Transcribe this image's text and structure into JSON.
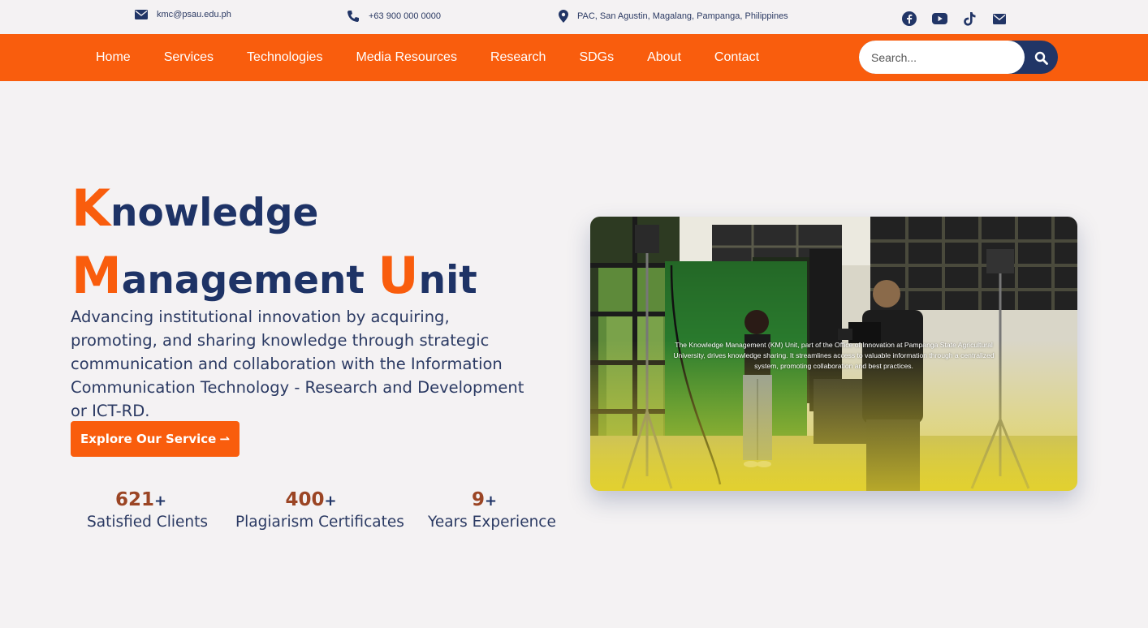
{
  "topbar": {
    "email": "kmc@psau.edu.ph",
    "phone": "+63 900 000 0000",
    "address": "PAC, San Agustin, Magalang, Pampanga, Philippines",
    "socials": [
      "facebook-icon",
      "youtube-icon",
      "tiktok-icon",
      "mail-icon"
    ]
  },
  "nav": {
    "items": [
      "Home",
      "Services",
      "Technologies",
      "Media Resources",
      "Research",
      "SDGs",
      "About",
      "Contact"
    ],
    "search_placeholder": "Search..."
  },
  "hero": {
    "title": {
      "k_cap": "K",
      "k_rest": "nowledge",
      "m_cap": "M",
      "m_rest": "anagement",
      "u_cap": "U",
      "u_rest": "nit"
    },
    "description": "Advancing institutional innovation by acquiring, promoting, and sharing knowledge through strategic communication and collaboration with the Information Communication Technology - Research and Development or ICT-RD.",
    "cta_label": "Explore Our Service",
    "cta_arrow": "⇀",
    "stats": [
      {
        "value": "621",
        "suffix": "+",
        "label": "Satisfied Clients"
      },
      {
        "value": "400",
        "suffix": "+",
        "label": "Plagiarism Certificates"
      },
      {
        "value": "9",
        "suffix": "+",
        "label": "Years Experience"
      }
    ],
    "media_caption": "The Knowledge Management (KM) Unit, part of the Office of Innovation at Pampanga State Agricultural University, drives knowledge sharing. It streamlines access to valuable information through a centralized system, promoting collaboration and best practices."
  },
  "colors": {
    "brand_orange": "#f95d0d",
    "navy": "#1e3366",
    "background": "#f4f2f3"
  }
}
